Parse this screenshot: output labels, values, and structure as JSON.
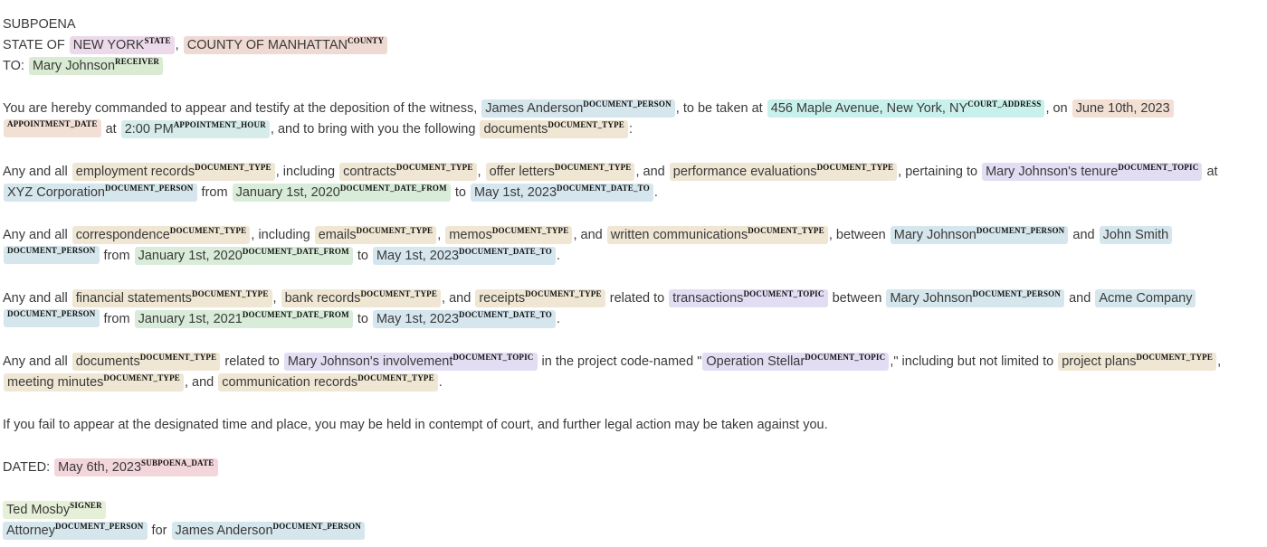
{
  "doc": {
    "title": "SUBPOENA",
    "state_line": {
      "prefix": "STATE OF",
      "state": "NEW YORK",
      "sep": ",",
      "county": "COUNTY OF MANHATTAN"
    },
    "to_line": {
      "prefix": "TO:",
      "receiver": "Mary Johnson"
    },
    "p1": {
      "t1": "You are hereby commanded to appear and testify at the deposition of the witness,",
      "person": "James Anderson",
      "t2": ", to be taken at",
      "address": "456 Maple Avenue, New York, NY",
      "t3": ", on",
      "date": "June 10th, 2023",
      "t4": "at",
      "hour": "2:00 PM",
      "t5": ", and to bring with you the following",
      "doctype": "documents",
      "t6": ":"
    },
    "p2": {
      "t1": "Any and all",
      "e1": "employment records",
      "t2": ", including",
      "e2": "contracts",
      "t3": ",",
      "e3": "offer letters",
      "t4": ", and",
      "e4": "performance evaluations",
      "t5": ", pertaining to",
      "topic": "Mary Johnson's tenure",
      "t6": "at",
      "person": "XYZ Corporation",
      "t7": "from",
      "from": "January 1st, 2020",
      "t8": "to",
      "to": "May 1st, 2023",
      "t9": "."
    },
    "p3": {
      "t1": "Any and all",
      "e1": "correspondence",
      "t2": ", including",
      "e2": "emails",
      "t3": ",",
      "e3": "memos",
      "t4": ", and",
      "e4": "written communications",
      "t5": ", between",
      "person1": "Mary Johnson",
      "t6": "and",
      "person2": "John Smith",
      "t7": "from",
      "from": "January 1st, 2020",
      "t8": "to",
      "to": "May 1st, 2023",
      "t9": "."
    },
    "p4": {
      "t1": "Any and all",
      "e1": "financial statements",
      "t2": ",",
      "e2": "bank records",
      "t3": ", and",
      "e3": "receipts",
      "t4": "related to",
      "topic": "transactions",
      "t5": "between",
      "person1": "Mary Johnson",
      "t6": "and",
      "person2": "Acme Company",
      "t7": "from",
      "from": "January 1st, 2021",
      "t8": "to",
      "to": "May 1st, 2023",
      "t9": "."
    },
    "p5": {
      "t1": "Any and all",
      "e1": "documents",
      "t2": "related to",
      "topic1": "Mary Johnson's involvement",
      "t3": "in the project code-named \"",
      "topic2": "Operation Stellar",
      "t4": ",\" including but not limited to",
      "e2": "project plans",
      "t5": ",",
      "e3": "meeting minutes",
      "t6": ", and",
      "e4": "communication records",
      "t7": "."
    },
    "p6": "If you fail to appear at the designated time and place, you may be held in contempt of court, and further legal action may be taken against you.",
    "dated": {
      "prefix": "DATED:",
      "date": "May 6th, 2023"
    },
    "signer": "Ted Mosby",
    "sign_line": {
      "role": "Attorney",
      "t1": "for",
      "client": "James Anderson"
    }
  },
  "labels": {
    "state": "STATE",
    "county": "COUNTY",
    "receiver": "RECEIVER",
    "document_person": "DOCUMENT_PERSON",
    "court_address": "COURT_ADDRESS",
    "appointment_date": "APPOINTMENT_DATE",
    "appointment_hour": "APPOINTMENT_HOUR",
    "document_type": "DOCUMENT_TYPE",
    "document_topic": "DOCUMENT_TOPIC",
    "document_date_from": "DOCUMENT_DATE_FROM",
    "document_date_to": "DOCUMENT_DATE_TO",
    "subpoena_date": "SUBPOENA_DATE",
    "signer": "SIGNER"
  },
  "colors": {
    "STATE": "#ecd9ea",
    "COUNTY": "#efd9d3",
    "RECEIVER": "#d9ecd3",
    "DOCUMENT_PERSON": "#d5e6ec",
    "COURT_ADDRESS": "#c9f1ec",
    "APPOINTMENT_DATE": "#f2e0d5",
    "APPOINTMENT_HOUR": "#d6ecea",
    "DOCUMENT_TYPE": "#efe6d3",
    "DOCUMENT_TOPIC": "#e2ddf3",
    "DOCUMENT_DATE_FROM": "#d9ecd9",
    "DOCUMENT_DATE_TO": "#d6e6ee",
    "SUBPOENA_DATE": "#f3d6dc",
    "SIGNER": "#e6efd7"
  }
}
